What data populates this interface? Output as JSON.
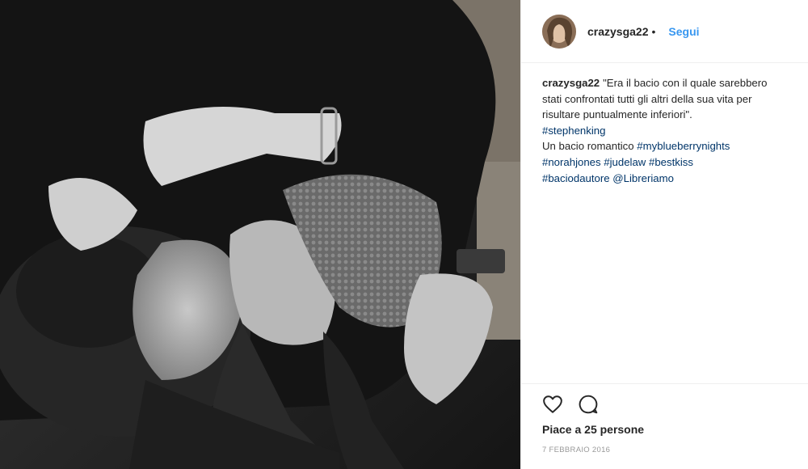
{
  "header": {
    "username": "crazysga22",
    "separator": "•",
    "follow_label": "Segui"
  },
  "caption": {
    "username": "crazysga22",
    "text": "\"Era il bacio con il quale sarebbero stati confrontati tutti gli altri della sua vita per risultare puntualmente inferiori\".",
    "hashtag_line1": "#stephenking",
    "text2": "Un bacio romantico",
    "hashtags": [
      "#myblueberrynights",
      "#norahjones",
      "#judelaw",
      "#bestkiss",
      "#baciodautore",
      "@Libreriamo"
    ]
  },
  "footer": {
    "likes": "Piace a 25 persone",
    "date": "7 FEBBRAIO 2016"
  },
  "icons": {
    "like": "heart-icon",
    "comment": "comment-icon"
  },
  "colors": {
    "link": "#003569",
    "follow": "#3897f0",
    "text": "#262626",
    "muted": "#999999"
  }
}
